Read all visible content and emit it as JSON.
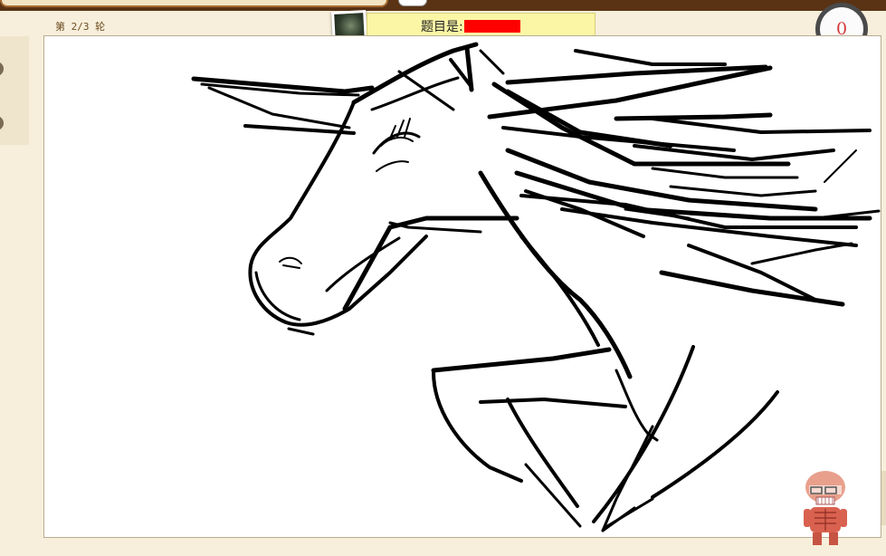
{
  "header": {
    "round_label": "第 2/3 轮",
    "prompt_label": "题目是:",
    "timer_value": "0"
  },
  "avatar": {
    "name": "avatar-icon"
  },
  "colors": {
    "background": "#f7efdb",
    "banner": "#fbf6a5",
    "answer_mask": "#ff0000",
    "timer_text": "#d23a3a",
    "ink": "#000000"
  },
  "canvas": {
    "drawing_subject_icon": "horse-sketch-icon"
  },
  "mascot": {
    "name": "giant-mascot-icon"
  }
}
